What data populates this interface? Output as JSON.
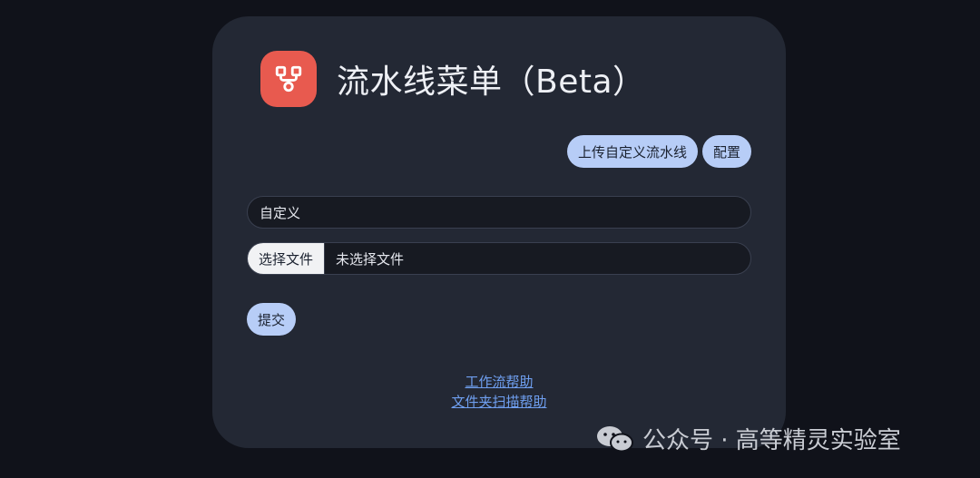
{
  "header": {
    "title": "流水线菜单（Beta）",
    "icon": "workflow-icon",
    "icon_color": "#e85a4f"
  },
  "actions": {
    "upload_label": "上传自定义流水线",
    "config_label": "配置"
  },
  "form": {
    "text_value": "自定义",
    "file_button_label": "选择文件",
    "file_status": "未选择文件",
    "submit_label": "提交"
  },
  "links": {
    "workflow_help": "工作流帮助",
    "folder_scan_help": "文件夹扫描帮助"
  },
  "watermark": {
    "text": "公众号 · 高等精灵实验室",
    "icon": "wechat-icon"
  },
  "colors": {
    "accent": "#b7cdf7",
    "link": "#6f9ff0",
    "card": "#232834",
    "background": "#10121a"
  }
}
